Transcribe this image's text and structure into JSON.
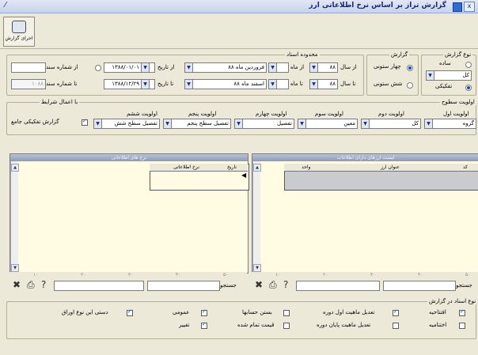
{
  "window": {
    "title": "گزارش تراز بر اساس نرخ اطلاعاتی ارز",
    "left_glyph": "⁄",
    "buttons": {
      "minimize": "_",
      "close": "x"
    }
  },
  "toolbar": {
    "run_label": "اجرای گزارش"
  },
  "report_type": {
    "label": "نوع گزارش",
    "options": [
      {
        "label": "ساده",
        "checked": false
      },
      {
        "label": "تفکیکی",
        "checked": true
      }
    ],
    "sub_value": "کل"
  },
  "report": {
    "label": "گزارش",
    "options": [
      {
        "label": "چهار ستونی",
        "checked": true
      },
      {
        "label": "شش ستونی",
        "checked": false
      }
    ]
  },
  "range": {
    "label": "محدوده اسناد",
    "from_year_label": "از سال",
    "from_year": "۸۸",
    "to_year_label": "تا سال",
    "to_year": "۸۸",
    "from_label": "از ماه",
    "to_label": "تا ماه",
    "month_from": "فروردین ماه ۸۸",
    "month_to": "اسفند ماه ۸۸",
    "from_date_label": "از تاریخ",
    "from_date": "۱۳۸۸/۰۱/۰۱",
    "to_date_label": "تا تاریخ",
    "to_date": "۱۳۸۸/۱۲/۲۹",
    "doc_from_label": "از شماره سند",
    "doc_from": "",
    "doc_to_label": "تا شماره سند",
    "doc_to": "۱۰۸۸"
  },
  "priority": {
    "label": "اولویت سطوح",
    "with_conditions": "با اعمال شرایط",
    "headers": [
      "اولویت اول",
      "اولویت دوم",
      "اولویت سوم",
      "اولویت چهارم",
      "اولویت پنجم",
      "اولویت ششم"
    ],
    "values": [
      "گروه",
      "کل",
      "معین",
      "تفصیل",
      "تفصیل سطح پنجم",
      "تفصیل سطح شش"
    ],
    "multilevel": "گزارش تفکیکی جامع"
  },
  "left_panel": {
    "title": "نرخ های اطلاعاتی",
    "columns": [
      "تاریخ",
      "نرخ اطلاعاتی"
    ],
    "search_label": "جستجو"
  },
  "right_panel": {
    "title": "لیست ارزهای دارای اطلاعات",
    "columns": [
      "کد",
      "عنوان ارز",
      "واحد"
    ],
    "search_label": "جستجو"
  },
  "ruler_ticks": [
    "۱۰",
    "۲۰",
    "۳۰",
    "۴۰",
    "۵۰"
  ],
  "print_options": {
    "label": "نوع اسناد در گزارش",
    "items": [
      {
        "label": "افتتاحیه",
        "checked": true
      },
      {
        "label": "اختتامیه",
        "checked": false
      },
      {
        "label": "تعدیل ماهیت اول دوره",
        "checked": true
      },
      {
        "label": "تعدیل ماهیت پایان دوره",
        "checked": false
      },
      {
        "label": "بستن حسابها",
        "checked": false
      },
      {
        "label": "قیمت تمام شده",
        "checked": false
      },
      {
        "label": "عمومی",
        "checked": true
      },
      {
        "label": "تغییر",
        "checked": true
      },
      {
        "label": "دستی این نوع اوراق",
        "checked": true
      }
    ]
  },
  "colors": {
    "panel_bg": "#fffce3",
    "window_bg": "#ece9d8",
    "panel_header": "#8d9ab8"
  }
}
